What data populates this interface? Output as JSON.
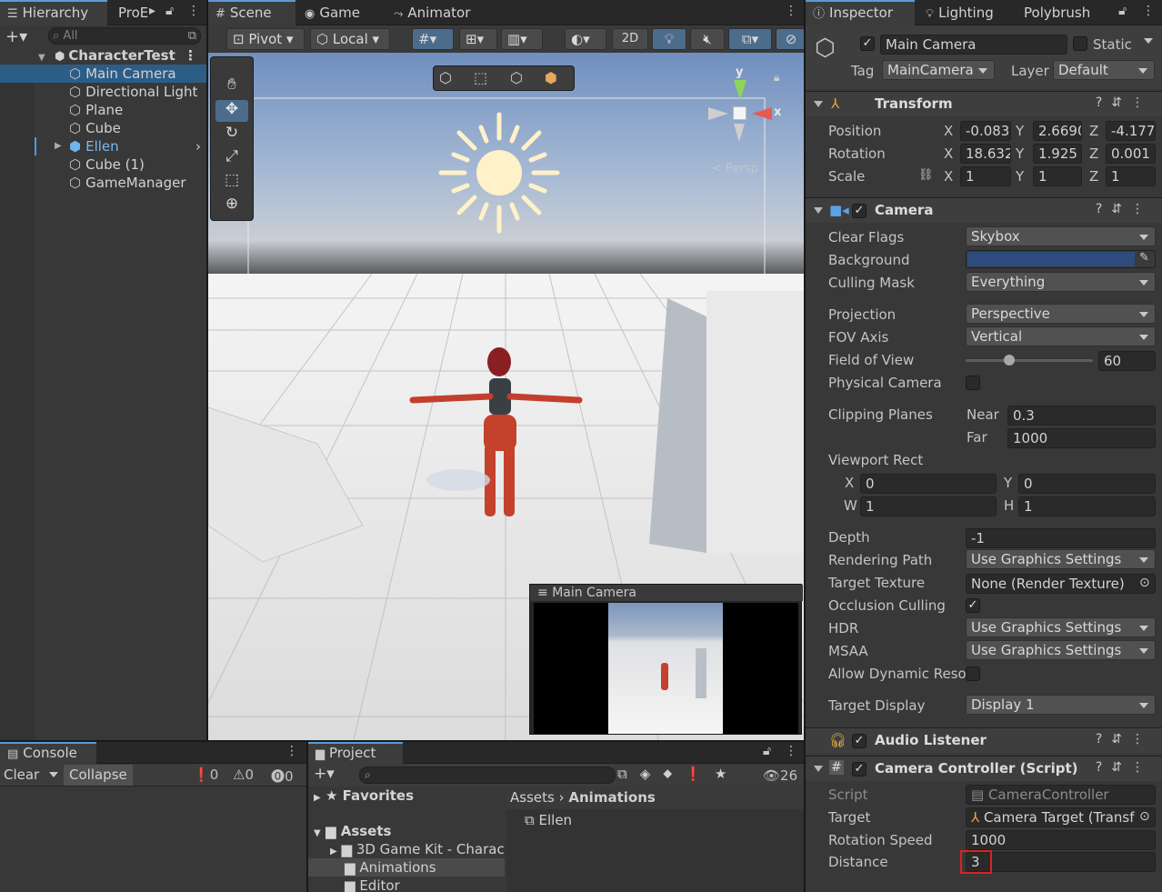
{
  "hierarchy": {
    "tab": "Hierarchy",
    "tab2": "ProE",
    "search_placeholder": "All",
    "scene": "CharacterTest",
    "items": [
      {
        "label": "Main Camera",
        "selected": true
      },
      {
        "label": "Directional Light"
      },
      {
        "label": "Plane"
      },
      {
        "label": "Cube"
      },
      {
        "label": "Ellen",
        "prefab": true
      },
      {
        "label": "Cube (1)"
      },
      {
        "label": "GameManager"
      }
    ]
  },
  "scene_view": {
    "tabs": [
      "Scene",
      "Game",
      "Animator"
    ],
    "pivot": "Pivot",
    "local": "Local",
    "btn_2d": "2D",
    "axis_y": "y",
    "axis_x": "x",
    "persp": "< Persp",
    "camera_preview_title": "Main Camera"
  },
  "inspector": {
    "tabs": [
      "Inspector",
      "Lighting",
      "Polybrush"
    ],
    "object_name": "Main Camera",
    "static_label": "Static",
    "tag_label": "Tag",
    "tag_value": "MainCamera",
    "layer_label": "Layer",
    "layer_value": "Default",
    "transform": {
      "title": "Transform",
      "position_label": "Position",
      "rotation_label": "Rotation",
      "scale_label": "Scale",
      "position": [
        "-0.083",
        "2.6690",
        "-4.177"
      ],
      "rotation": [
        "18.632",
        "1.925",
        "0.001"
      ],
      "scale": [
        "1",
        "1",
        "1"
      ]
    },
    "camera": {
      "title": "Camera",
      "clear_flags_label": "Clear Flags",
      "clear_flags": "Skybox",
      "background_label": "Background",
      "background_color": "#2d4b7c",
      "culling_mask_label": "Culling Mask",
      "culling_mask": "Everything",
      "projection_label": "Projection",
      "projection": "Perspective",
      "fov_axis_label": "FOV Axis",
      "fov_axis": "Vertical",
      "fov_label": "Field of View",
      "fov": "60",
      "physical_label": "Physical Camera",
      "clipping_label": "Clipping Planes",
      "near_label": "Near",
      "near": "0.3",
      "far_label": "Far",
      "far": "1000",
      "viewport_label": "Viewport Rect",
      "vx": "0",
      "vy": "0",
      "vw": "1",
      "vh": "1",
      "depth_label": "Depth",
      "depth": "-1",
      "rendering_path_label": "Rendering Path",
      "rendering_path": "Use Graphics Settings",
      "target_texture_label": "Target Texture",
      "target_texture": "None (Render Texture)",
      "occlusion_label": "Occlusion Culling",
      "hdr_label": "HDR",
      "hdr": "Use Graphics Settings",
      "msaa_label": "MSAA",
      "msaa": "Use Graphics Settings",
      "dyn_res_label": "Allow Dynamic Reso",
      "target_display_label": "Target Display",
      "target_display": "Display 1"
    },
    "audio_listener": {
      "title": "Audio Listener"
    },
    "camera_controller": {
      "title": "Camera Controller (Script)",
      "script_label": "Script",
      "script": "CameraController",
      "target_label": "Target",
      "target": "Camera Target (Transf",
      "rotation_speed_label": "Rotation Speed",
      "rotation_speed": "1000",
      "distance_label": "Distance",
      "distance": "3"
    }
  },
  "console": {
    "tab": "Console",
    "clear": "Clear",
    "collapse": "Collapse",
    "count_log": "0",
    "count_warn": "0",
    "count_err": "0"
  },
  "project": {
    "tab": "Project",
    "favorites": "Favorites",
    "assets": "Assets",
    "folders": [
      "3D Game Kit - Charac",
      "Animations",
      "Editor"
    ],
    "breadcrumb_root": "Assets",
    "breadcrumb_leaf": "Animations",
    "file": "Ellen",
    "visible_count": "26"
  }
}
